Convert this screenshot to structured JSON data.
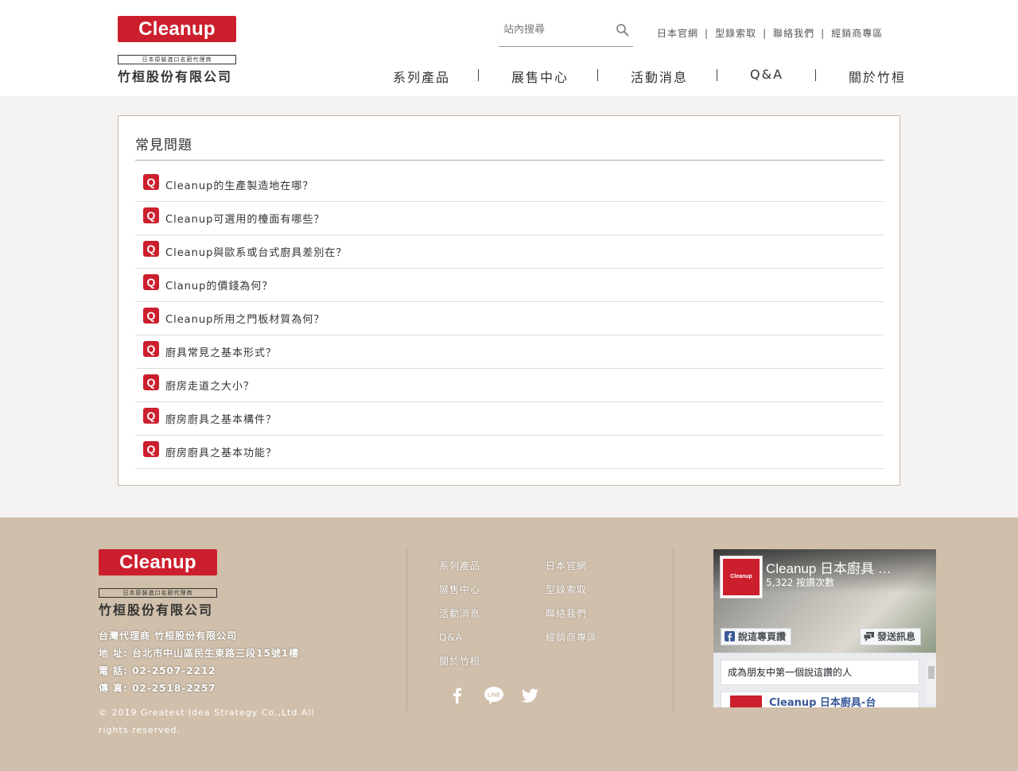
{
  "brand": {
    "logo_text": "Cleanup",
    "tagline": "日本原裝進口名廚代理商",
    "company": "竹桓股份有限公司",
    "accent_color": "#cc1f2d"
  },
  "header": {
    "search_placeholder": "站內搜尋",
    "top_links": [
      "日本官網",
      "型錄索取",
      "聯絡我們",
      "經銷商專區"
    ],
    "top_link_separator": "|",
    "nav": [
      "系列產品",
      "展售中心",
      "活動消息",
      "Q&A",
      "關於竹桓"
    ]
  },
  "faq": {
    "title": "常見問題",
    "badge": "Q",
    "items": [
      "Cleanup的生產製造地在哪？",
      "Cleanup可選用的檯面有哪些？",
      "Cleanup與歐系或台式廚具差別在？",
      "Clanup的價錢為何？",
      "Cleanup所用之門板材質為何？",
      "廚具常見之基本形式？",
      "廚房走道之大小？",
      "廚房廚具之基本構件？",
      "廚房廚具之基本功能？"
    ]
  },
  "footer": {
    "info": [
      "台灣代理商 竹桓股份有限公司",
      "地 址: 台北市中山區民生東路三段15號1樓",
      "電 話: 02-2507-2212",
      "傳 真: 02-2518-2257"
    ],
    "copyright": "© 2019 Greatest Idea Strategy Co.,Ltd All rights reserved.",
    "links_col1": [
      "系列產品",
      "展售中心",
      "活動消息",
      "Q&A",
      "關於竹桓"
    ],
    "links_col2": [
      "日本官網",
      "型錄索取",
      "聯絡我們",
      "經銷商專區"
    ],
    "social_icons": [
      "facebook-icon",
      "line-icon",
      "twitter-icon"
    ],
    "background_color": "#d0bfaa"
  },
  "facebook_widget": {
    "page_name": "Cleanup 日本廚具 …",
    "likes": "5,322 按讚次數",
    "like_button": "說這專頁讚",
    "message_button": "發送訊息",
    "friends_text": "成為朋友中第一個說這讚的人",
    "post_peek": "Cleanup 日本廚具-台"
  }
}
